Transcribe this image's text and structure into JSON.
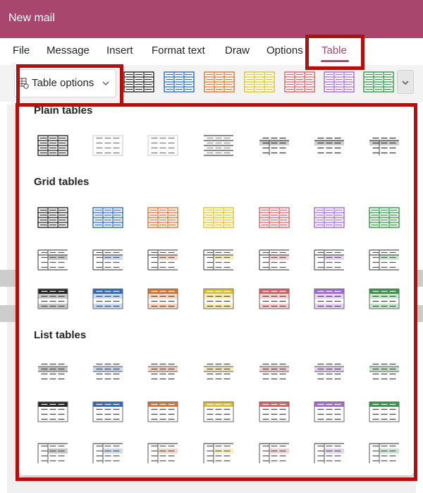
{
  "window": {
    "title": "New mail"
  },
  "ribbon_tabs": [
    "File",
    "Message",
    "Insert",
    "Format text",
    "Draw",
    "Options",
    "Table"
  ],
  "active_tab": "Table",
  "toolbar": {
    "table_options_label": "Table options",
    "table_options_icon": "table-settings-icon",
    "dropdown_icon": "chevron-down-icon",
    "gallery_colors": [
      "#262626",
      "#2b6cc4",
      "#e2722a",
      "#e3c21f",
      "#e05d63",
      "#a867df",
      "#2e9b41"
    ]
  },
  "gallery": {
    "sections": [
      {
        "title": "Plain tables",
        "rows": [
          [
            "plain-grid",
            "plain-light",
            "plain-light2",
            "plain-lines",
            "plain-band-dark",
            "plain-band",
            "plain-mid"
          ]
        ]
      },
      {
        "title": "Grid tables",
        "rows": [
          [
            "grid1",
            "grid1",
            "grid1",
            "grid1",
            "grid1",
            "grid1",
            "grid1"
          ],
          [
            "grid2",
            "grid2",
            "grid2",
            "grid2",
            "grid2",
            "grid2",
            "grid2"
          ],
          [
            "grid3",
            "grid3",
            "grid3",
            "grid3",
            "grid3",
            "grid3",
            "grid3"
          ]
        ]
      },
      {
        "title": "List tables",
        "rows": [
          [
            "list1",
            "list1",
            "list1",
            "list1",
            "list1",
            "list1",
            "list1"
          ],
          [
            "list2",
            "list2",
            "list2",
            "list2",
            "list2",
            "list2",
            "list2"
          ],
          [
            "list3",
            "list3",
            "list3",
            "list3",
            "list3",
            "list3",
            "list3"
          ]
        ]
      }
    ],
    "colors": [
      "#262626",
      "#2b6cc4",
      "#e2722a",
      "#e3c21f",
      "#e05d63",
      "#a867df",
      "#2e9b41"
    ],
    "tints": [
      "#c8c8c8",
      "#c8dbf3",
      "#f8d6c2",
      "#f8efb8",
      "#f6d0d2",
      "#e6d3f6",
      "#c9e8cf"
    ],
    "highlight_color": "#b30f0f"
  }
}
